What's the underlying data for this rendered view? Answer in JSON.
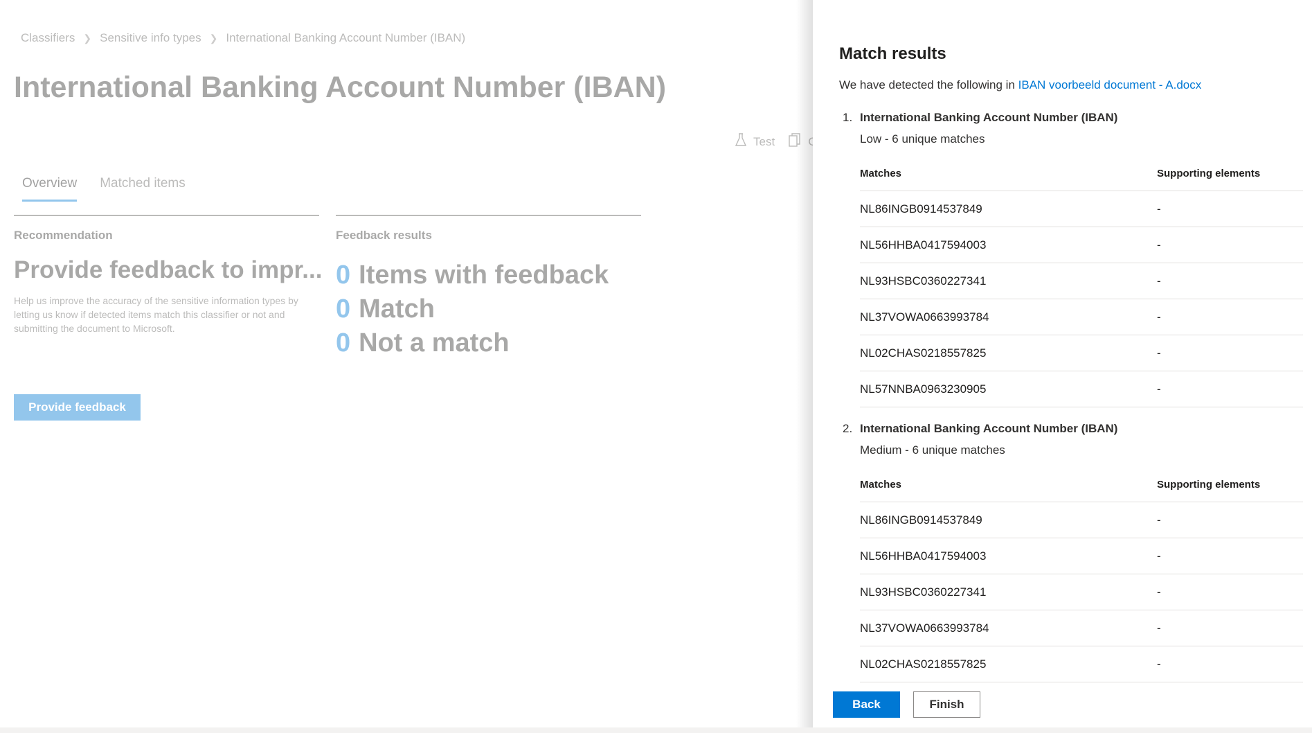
{
  "breadcrumb": [
    "Classifiers",
    "Sensitive info types",
    "International Banking Account Number (IBAN)"
  ],
  "page_title": "International Banking Account Number (IBAN)",
  "command_bar": {
    "test_label": "Test",
    "copy_label": "C"
  },
  "tabs": [
    {
      "label": "Overview",
      "active": true
    },
    {
      "label": "Matched items",
      "active": false
    }
  ],
  "recommendation": {
    "label": "Recommendation",
    "heading": "Provide feedback to impr...",
    "description": "Help us improve the accuracy of the sensitive information types by letting us know if detected items match this classifier or not and submitting the document to Microsoft.",
    "button": "Provide feedback"
  },
  "feedback_results": {
    "label": "Feedback results",
    "items": [
      {
        "count": "0",
        "label": "Items with feedback"
      },
      {
        "count": "0",
        "label": "Match"
      },
      {
        "count": "0",
        "label": "Not a match"
      }
    ]
  },
  "panel": {
    "title": "Match results",
    "description_prefix": "We have detected the following in",
    "document_link": "IBAN voorbeeld document - A.docx",
    "results": [
      {
        "index": "1.",
        "name": "International Banking Account Number (IBAN)",
        "summary": "Low - 6 unique matches",
        "col_matches": "Matches",
        "col_supporting": "Supporting elements",
        "rows": [
          {
            "match": "NL86INGB0914537849",
            "supporting": "-"
          },
          {
            "match": "NL56HHBA0417594003",
            "supporting": "-"
          },
          {
            "match": "NL93HSBC0360227341",
            "supporting": "-"
          },
          {
            "match": "NL37VOWA0663993784",
            "supporting": "-"
          },
          {
            "match": "NL02CHAS0218557825",
            "supporting": "-"
          },
          {
            "match": "NL57NNBA0963230905",
            "supporting": "-"
          }
        ]
      },
      {
        "index": "2.",
        "name": "International Banking Account Number (IBAN)",
        "summary": "Medium - 6 unique matches",
        "col_matches": "Matches",
        "col_supporting": "Supporting elements",
        "rows": [
          {
            "match": "NL86INGB0914537849",
            "supporting": "-"
          },
          {
            "match": "NL56HHBA0417594003",
            "supporting": "-"
          },
          {
            "match": "NL93HSBC0360227341",
            "supporting": "-"
          },
          {
            "match": "NL37VOWA0663993784",
            "supporting": "-"
          },
          {
            "match": "NL02CHAS0218557825",
            "supporting": "-"
          }
        ]
      }
    ],
    "back_button": "Back",
    "finish_button": "Finish"
  },
  "colors": {
    "accent": "#0078d4",
    "text": "#323130"
  },
  "icons": {
    "breadcrumb_separator": "chevron-right-icon",
    "test": "flask-icon",
    "copy": "copy-icon"
  }
}
